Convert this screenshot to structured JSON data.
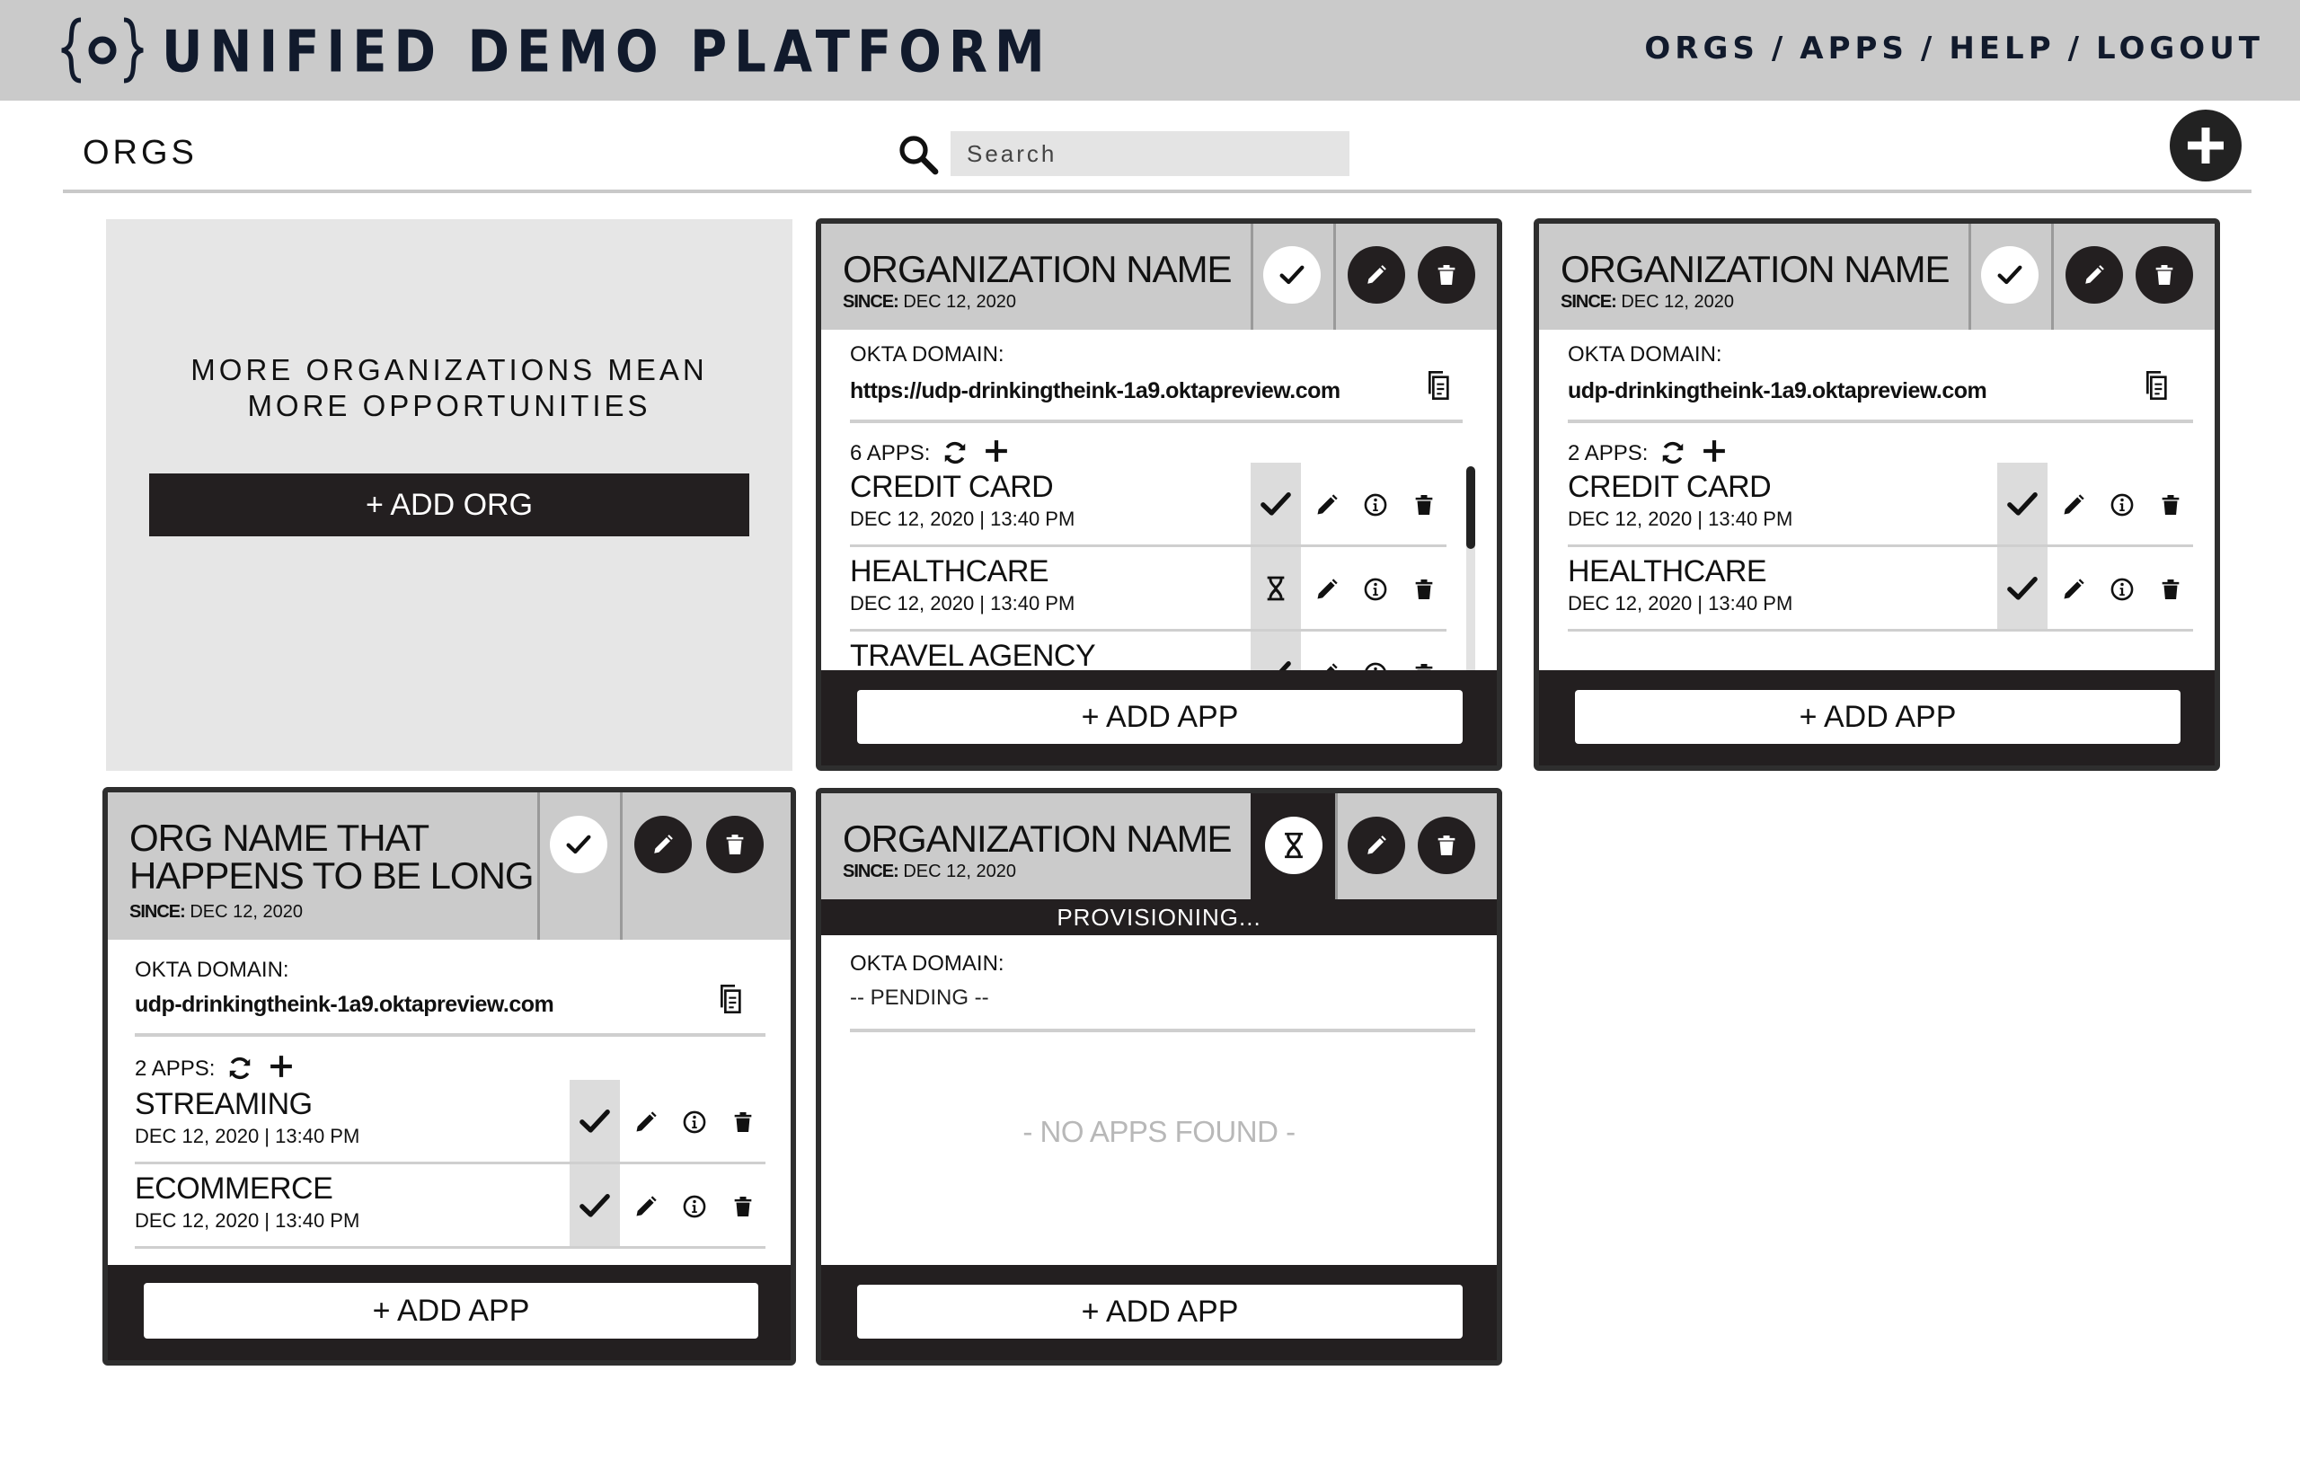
{
  "header": {
    "logo_text": "{o}",
    "title": "UNIFIED DEMO PLATFORM",
    "nav": [
      "ORGS",
      "APPS",
      "HELP",
      "LOGOUT"
    ],
    "nav_separator": "/"
  },
  "toolbar": {
    "page_title": "ORGS",
    "search_placeholder": "Search"
  },
  "promo": {
    "line1": "MORE ORGANIZATIONS MEAN",
    "line2": "MORE OPPORTUNITIES",
    "button": "+ ADD ORG"
  },
  "labels": {
    "since": "SINCE:",
    "okta_domain": "OKTA DOMAIN:",
    "add_app": "+ ADD APP"
  },
  "orgs": [
    {
      "name": "ORGANIZATION NAME",
      "since": "DEC 12, 2020",
      "status": "active",
      "domain": "https://udp-drinkingtheink-1a9.oktapreview.com",
      "apps_label": "6 APPS:",
      "apps": [
        {
          "name": "CREDIT CARD",
          "date": "DEC 12, 2020 | 13:40 PM",
          "status": "active"
        },
        {
          "name": "HEALTHCARE",
          "date": "DEC 12, 2020 | 13:40 PM",
          "status": "pending"
        },
        {
          "name": "TRAVEL AGENCY",
          "date": "",
          "status": "active"
        }
      ]
    },
    {
      "name": "ORGANIZATION NAME",
      "since": "DEC 12, 2020",
      "status": "active",
      "domain": "udp-drinkingtheink-1a9.oktapreview.com",
      "apps_label": "2 APPS:",
      "apps": [
        {
          "name": "CREDIT CARD",
          "date": "DEC 12, 2020 | 13:40 PM",
          "status": "active"
        },
        {
          "name": "HEALTHCARE",
          "date": "DEC 12, 2020 | 13:40 PM",
          "status": "active"
        }
      ]
    },
    {
      "name_line1": "ORG NAME THAT",
      "name_line2": "HAPPENS TO BE LONG",
      "since": "DEC 12, 2020",
      "status": "active",
      "domain": "udp-drinkingtheink-1a9.oktapreview.com",
      "apps_label": "2 APPS:",
      "apps": [
        {
          "name": "STREAMING",
          "date": "DEC 12, 2020 | 13:40 PM",
          "status": "active"
        },
        {
          "name": "ECOMMERCE",
          "date": "DEC 12, 2020 | 13:40 PM",
          "status": "active"
        }
      ]
    },
    {
      "name": "ORGANIZATION NAME",
      "since": "DEC 12, 2020",
      "status": "provisioning",
      "banner": "PROVISIONING...",
      "domain": "-- PENDING --",
      "empty_text": "- NO APPS FOUND -"
    }
  ],
  "colors": {
    "header_bg": "#cacaca",
    "ink": "#231f20",
    "card_head": "#cbcbcb",
    "muted": "#b8b8b8"
  }
}
